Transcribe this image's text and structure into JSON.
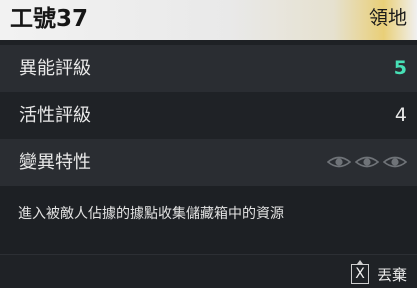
{
  "header": {
    "title": "工號37",
    "tag": "領地"
  },
  "stats": [
    {
      "label": "異能評級",
      "value": "5",
      "accent": true
    },
    {
      "label": "活性評級",
      "value": "4",
      "accent": false
    },
    {
      "label": "變異特性",
      "value": "",
      "icons": [
        "eye-icon",
        "eye-icon",
        "eye-icon"
      ]
    }
  ],
  "description": "進入被敵人佔據的據點收集儲藏箱中的資源",
  "footer": {
    "key": "X",
    "action_label": "丟棄"
  },
  "colors": {
    "accent": "#47e0b6",
    "panel_bg": "#1e2125",
    "row_alt_bg": "#2a2d32",
    "header_gold": "#e9cf78"
  }
}
